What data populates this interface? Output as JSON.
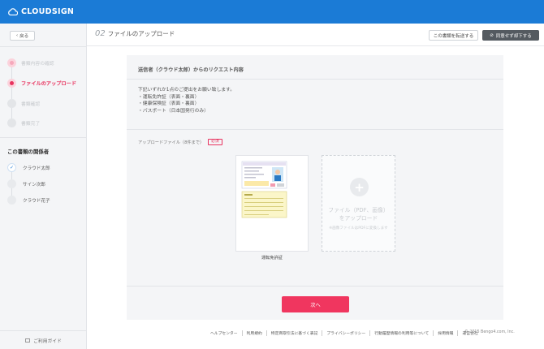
{
  "app": {
    "brand": "CLOUDSIGN",
    "brand_color": "#1b7bd6",
    "accent_color": "#f0365f"
  },
  "sidebar": {
    "back_label": "戻る",
    "steps": [
      {
        "label": "書類内容の確認",
        "state": "done"
      },
      {
        "label": "ファイルのアップロード",
        "state": "active"
      },
      {
        "label": "書類確認",
        "state": "pending"
      },
      {
        "label": "書類完了",
        "state": "pending"
      }
    ],
    "relations_title": "この書類の関係者",
    "relations": [
      {
        "name": "クラウド太郎",
        "checked": true
      },
      {
        "name": "サイン次郎",
        "checked": false
      },
      {
        "name": "クラウド花子",
        "checked": false
      }
    ],
    "guide_label": "ご利用ガイド"
  },
  "header": {
    "step_number": "02",
    "title": "ファイルのアップロード",
    "transfer_label": "この書類を転送する",
    "decline_label": "同意せず却下する"
  },
  "request": {
    "title": "送信者（クラウド太郎）からのリクエスト内容",
    "intro": "下記いずれか1点のご提出をお願い致します。",
    "items": [
      "・運転免許証（表面・裏面）",
      "・健康保険証（表面・裏面）",
      "・パスポート（日本国発行のみ）"
    ]
  },
  "upload": {
    "label": "アップロードファイル（8件まで）",
    "required": "必須",
    "files": [
      {
        "name": "運転免許証"
      }
    ],
    "drop_title_1": "ファイル（PDF、画像）",
    "drop_title_2": "をアップロード",
    "drop_note": "※画像ファイルはPDFに変換します"
  },
  "next_label": "次へ",
  "footer": {
    "links": [
      "ヘルプセンター",
      "利用規約",
      "特定商取引法に基づく表記",
      "プライバシーポリシー",
      "行動履歴情報の利用等について",
      "採用情報",
      "運営会社"
    ],
    "copyright": "© 2015 Bengo4.com, Inc."
  }
}
